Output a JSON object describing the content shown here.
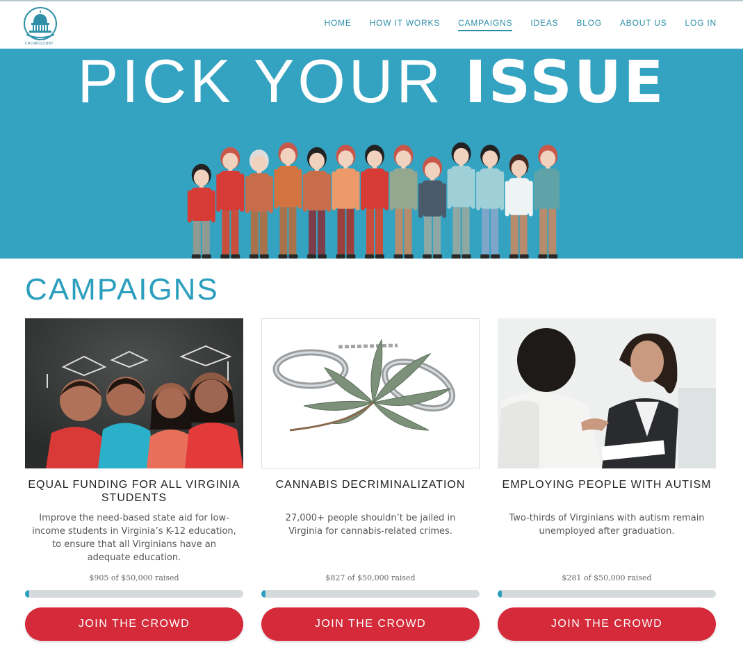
{
  "nav": {
    "logo_text": "CROWDLOBBY",
    "items": [
      {
        "label": "HOME",
        "active": false
      },
      {
        "label": "HOW IT WORKS",
        "active": false
      },
      {
        "label": "CAMPAIGNS",
        "active": true
      },
      {
        "label": "IDEAS",
        "active": false
      },
      {
        "label": "BLOG",
        "active": false
      },
      {
        "label": "ABOUT US",
        "active": false
      },
      {
        "label": "LOG IN",
        "active": false
      }
    ]
  },
  "hero": {
    "title_light": "PICK YOUR ",
    "title_bold": "ISSUE",
    "background": "#34a3c1"
  },
  "section_title": "CAMPAIGNS",
  "campaigns": [
    {
      "title": "EQUAL FUNDING FOR ALL VIRGINIA STUDENTS",
      "description": "Improve the need-based state aid for low-income students in Virginia’s K-12 education, to ensure that all Virginians have an adequate education.",
      "raised_text": "$905 of $50,000 raised",
      "progress": 0.018,
      "button": "JOIN THE CROWD",
      "image": "children-graduation-photo"
    },
    {
      "title": "CANNABIS DECRIMINALIZATION",
      "description": "27,000+ people shouldn’t be jailed in Virginia for cannabis-related crimes.",
      "raised_text": "$827 of $50,000 raised",
      "progress": 0.0165,
      "button": "JOIN THE CROWD",
      "image": "handcuffs-cannabis-leaf-photo"
    },
    {
      "title": "EMPLOYING PEOPLE WITH AUTISM",
      "description": "Two-thirds of Virginians with autism remain unemployed after graduation.",
      "raised_text": "$281 of $50,000 raised",
      "progress": 0.0056,
      "button": "JOIN THE CROWD",
      "image": "job-interview-handshake-photo"
    }
  ],
  "colors": {
    "accent": "#2c9fbe",
    "button": "#d42a3a",
    "bar_track": "#d5dadc"
  }
}
